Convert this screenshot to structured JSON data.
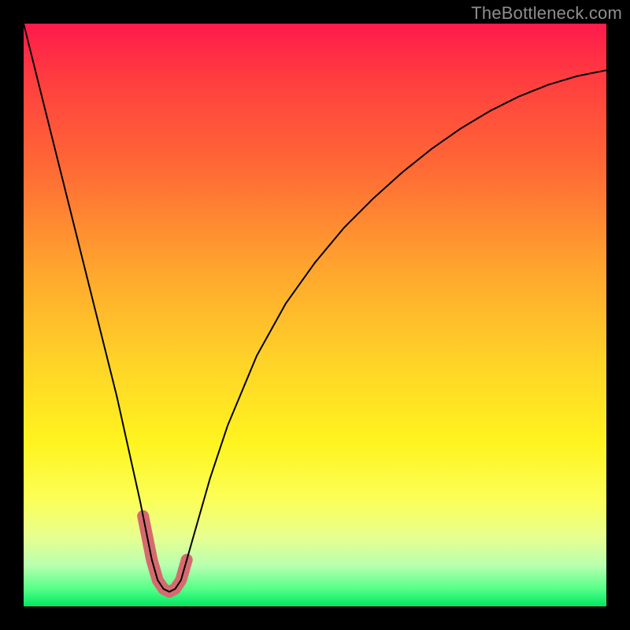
{
  "watermark": "TheBottleneck.com",
  "chart_data": {
    "type": "line",
    "title": "",
    "xlabel": "",
    "ylabel": "",
    "xlim": [
      0,
      100
    ],
    "ylim": [
      0,
      100
    ],
    "x": [
      0,
      2,
      4,
      6,
      8,
      10,
      12,
      14,
      16,
      18,
      20,
      21,
      22,
      23,
      24,
      25,
      26,
      27,
      28,
      30,
      32,
      35,
      40,
      45,
      50,
      55,
      60,
      65,
      70,
      75,
      80,
      85,
      90,
      95,
      100
    ],
    "values": [
      100,
      92,
      84,
      76,
      68,
      60,
      52,
      44,
      36,
      27,
      18,
      13,
      8,
      4.5,
      3,
      2.5,
      3,
      4.5,
      8,
      15,
      22,
      31,
      43,
      52,
      59,
      65,
      70,
      74.5,
      78.5,
      82,
      85,
      87.5,
      89.5,
      91,
      92
    ],
    "highlight_band": {
      "x_from": 20.5,
      "x_to": 28,
      "color": "#d56a6f",
      "stroke_width_px": 15
    },
    "curve_stroke_px": 2,
    "curve_color": "#000000"
  }
}
